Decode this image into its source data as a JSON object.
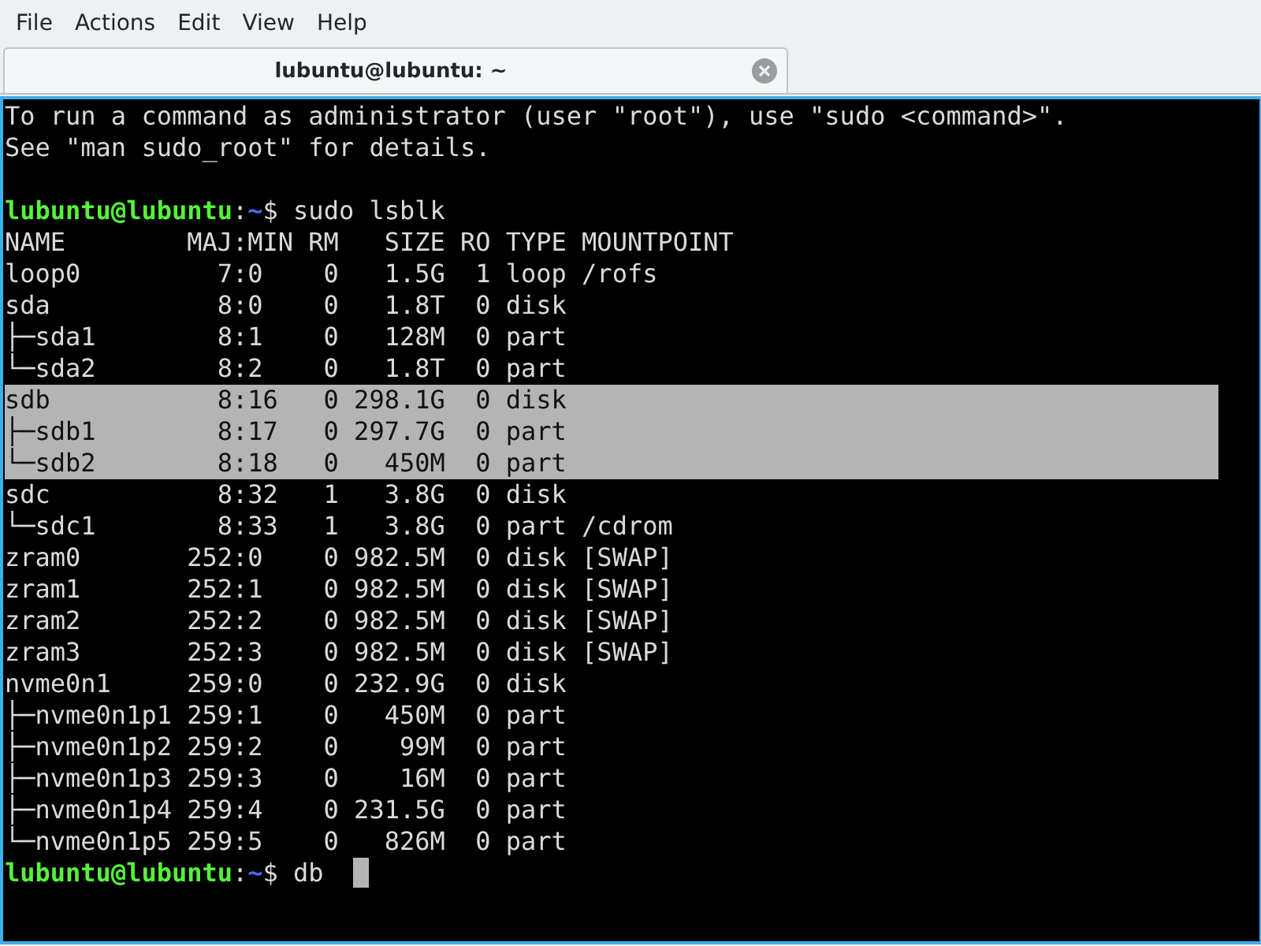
{
  "menu": [
    "File",
    "Actions",
    "Edit",
    "View",
    "Help"
  ],
  "tabs": [
    {
      "title": "lubuntu@lubuntu: ~",
      "selected": true
    }
  ],
  "terminal": {
    "lines": [
      {
        "kind": "text",
        "text": "To run a command as administrator (user \"root\"), use \"sudo <command>\".",
        "selected": false
      },
      {
        "kind": "text",
        "text": "See \"man sudo_root\" for details.",
        "selected": false
      },
      {
        "kind": "blank"
      },
      {
        "kind": "prompt",
        "user": "lubuntu@lubuntu",
        "separator": ":",
        "path": "~",
        "command": "$ sudo lsblk",
        "cursor": false
      },
      {
        "kind": "text",
        "text": "NAME        MAJ:MIN RM   SIZE RO TYPE MOUNTPOINT",
        "selected": false
      },
      {
        "kind": "text",
        "text": "loop0         7:0    0   1.5G  1 loop /rofs",
        "selected": false
      },
      {
        "kind": "text",
        "text": "sda           8:0    0   1.8T  0 disk",
        "selected": false
      },
      {
        "kind": "text",
        "text": "├─sda1        8:1    0   128M  0 part",
        "selected": false
      },
      {
        "kind": "text",
        "text": "└─sda2        8:2    0   1.8T  0 part",
        "selected": false
      },
      {
        "kind": "text",
        "text": "sdb           8:16   0 298.1G  0 disk",
        "selected": true
      },
      {
        "kind": "text",
        "text": "├─sdb1        8:17   0 297.7G  0 part",
        "selected": true
      },
      {
        "kind": "text",
        "text": "└─sdb2        8:18   0   450M  0 part",
        "selected": true
      },
      {
        "kind": "text",
        "text": "sdc           8:32   1   3.8G  0 disk",
        "selected": false
      },
      {
        "kind": "text",
        "text": "└─sdc1        8:33   1   3.8G  0 part /cdrom",
        "selected": false
      },
      {
        "kind": "text",
        "text": "zram0       252:0    0 982.5M  0 disk [SWAP]",
        "selected": false
      },
      {
        "kind": "text",
        "text": "zram1       252:1    0 982.5M  0 disk [SWAP]",
        "selected": false
      },
      {
        "kind": "text",
        "text": "zram2       252:2    0 982.5M  0 disk [SWAP]",
        "selected": false
      },
      {
        "kind": "text",
        "text": "zram3       252:3    0 982.5M  0 disk [SWAP]",
        "selected": false
      },
      {
        "kind": "text",
        "text": "nvme0n1     259:0    0 232.9G  0 disk",
        "selected": false
      },
      {
        "kind": "text",
        "text": "├─nvme0n1p1 259:1    0   450M  0 part",
        "selected": false
      },
      {
        "kind": "text",
        "text": "├─nvme0n1p2 259:2    0    99M  0 part",
        "selected": false
      },
      {
        "kind": "text",
        "text": "├─nvme0n1p3 259:3    0    16M  0 part",
        "selected": false
      },
      {
        "kind": "text",
        "text": "├─nvme0n1p4 259:4    0 231.5G  0 part",
        "selected": false
      },
      {
        "kind": "text",
        "text": "└─nvme0n1p5 259:5    0   826M  0 part",
        "selected": false
      },
      {
        "kind": "prompt",
        "user": "lubuntu@lubuntu",
        "separator": ":",
        "path": "~",
        "command": "$ db ",
        "cursor": true
      }
    ]
  }
}
